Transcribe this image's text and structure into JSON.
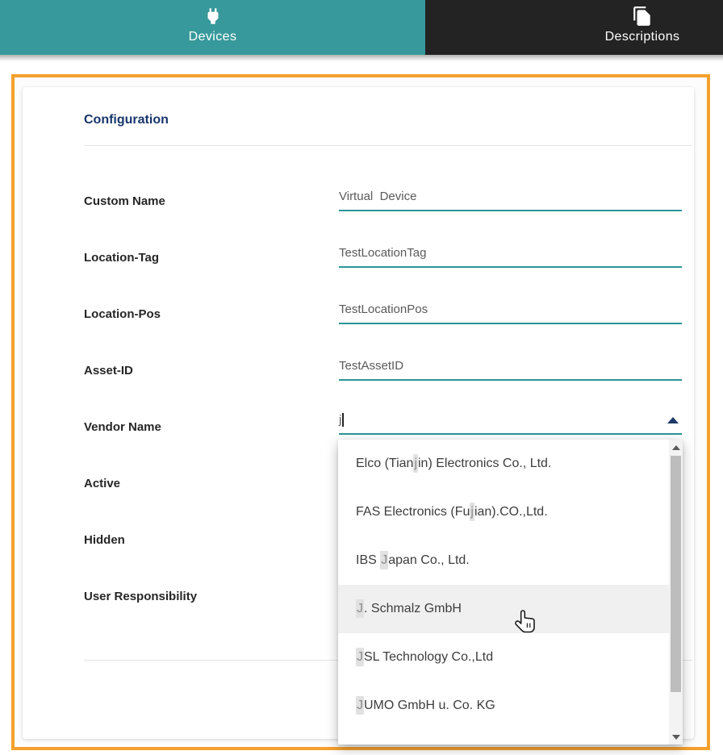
{
  "tabs": [
    {
      "label": "Devices",
      "icon": "power-plug-icon",
      "active": true
    },
    {
      "label": "Descriptions",
      "icon": "documents-icon",
      "active": false
    }
  ],
  "panel": {
    "title": "Configuration"
  },
  "fields": [
    {
      "label": "Custom Name",
      "value": "Virtual  Device"
    },
    {
      "label": "Location-Tag",
      "value": "TestLocationTag"
    },
    {
      "label": "Location-Pos",
      "value": "TestLocationPos"
    },
    {
      "label": "Asset-ID",
      "value": "TestAssetID"
    },
    {
      "label": "Vendor Name",
      "value": "j"
    }
  ],
  "extra_labels": [
    "Active",
    "Hidden",
    "User Responsibility"
  ],
  "vendor_dropdown": {
    "options": [
      {
        "pre": "Elco (Tian",
        "match": "j",
        "post": "in) Electronics Co., Ltd."
      },
      {
        "pre": "FAS Electronics (Fu",
        "match": "j",
        "post": "ian).CO.,Ltd."
      },
      {
        "pre": "IBS ",
        "match": "J",
        "post": "apan Co., Ltd."
      },
      {
        "pre": "",
        "match": "J",
        "post": ". Schmalz GmbH"
      },
      {
        "pre": "",
        "match": "J",
        "post": "SL Technology Co.,Ltd"
      },
      {
        "pre": "",
        "match": "J",
        "post": "UMO GmbH u. Co. KG"
      }
    ],
    "hovered_index": 3
  },
  "colors": {
    "accent_teal": "#37999B",
    "tab_dark": "#232323",
    "frame_orange": "#F5A02E",
    "heading_navy": "#17366B",
    "underline_teal": "#2A9598"
  }
}
